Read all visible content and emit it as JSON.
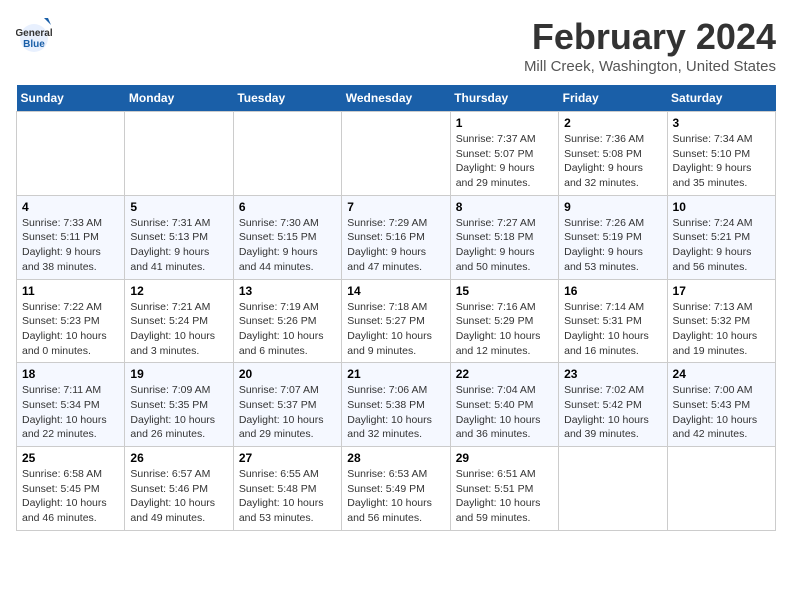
{
  "header": {
    "month_year": "February 2024",
    "location": "Mill Creek, Washington, United States",
    "logo_line1": "General",
    "logo_line2": "Blue"
  },
  "days_of_week": [
    "Sunday",
    "Monday",
    "Tuesday",
    "Wednesday",
    "Thursday",
    "Friday",
    "Saturday"
  ],
  "weeks": [
    [
      {
        "day": "",
        "info": ""
      },
      {
        "day": "",
        "info": ""
      },
      {
        "day": "",
        "info": ""
      },
      {
        "day": "",
        "info": ""
      },
      {
        "day": "1",
        "info": "Sunrise: 7:37 AM\nSunset: 5:07 PM\nDaylight: 9 hours\nand 29 minutes."
      },
      {
        "day": "2",
        "info": "Sunrise: 7:36 AM\nSunset: 5:08 PM\nDaylight: 9 hours\nand 32 minutes."
      },
      {
        "day": "3",
        "info": "Sunrise: 7:34 AM\nSunset: 5:10 PM\nDaylight: 9 hours\nand 35 minutes."
      }
    ],
    [
      {
        "day": "4",
        "info": "Sunrise: 7:33 AM\nSunset: 5:11 PM\nDaylight: 9 hours\nand 38 minutes."
      },
      {
        "day": "5",
        "info": "Sunrise: 7:31 AM\nSunset: 5:13 PM\nDaylight: 9 hours\nand 41 minutes."
      },
      {
        "day": "6",
        "info": "Sunrise: 7:30 AM\nSunset: 5:15 PM\nDaylight: 9 hours\nand 44 minutes."
      },
      {
        "day": "7",
        "info": "Sunrise: 7:29 AM\nSunset: 5:16 PM\nDaylight: 9 hours\nand 47 minutes."
      },
      {
        "day": "8",
        "info": "Sunrise: 7:27 AM\nSunset: 5:18 PM\nDaylight: 9 hours\nand 50 minutes."
      },
      {
        "day": "9",
        "info": "Sunrise: 7:26 AM\nSunset: 5:19 PM\nDaylight: 9 hours\nand 53 minutes."
      },
      {
        "day": "10",
        "info": "Sunrise: 7:24 AM\nSunset: 5:21 PM\nDaylight: 9 hours\nand 56 minutes."
      }
    ],
    [
      {
        "day": "11",
        "info": "Sunrise: 7:22 AM\nSunset: 5:23 PM\nDaylight: 10 hours\nand 0 minutes."
      },
      {
        "day": "12",
        "info": "Sunrise: 7:21 AM\nSunset: 5:24 PM\nDaylight: 10 hours\nand 3 minutes."
      },
      {
        "day": "13",
        "info": "Sunrise: 7:19 AM\nSunset: 5:26 PM\nDaylight: 10 hours\nand 6 minutes."
      },
      {
        "day": "14",
        "info": "Sunrise: 7:18 AM\nSunset: 5:27 PM\nDaylight: 10 hours\nand 9 minutes."
      },
      {
        "day": "15",
        "info": "Sunrise: 7:16 AM\nSunset: 5:29 PM\nDaylight: 10 hours\nand 12 minutes."
      },
      {
        "day": "16",
        "info": "Sunrise: 7:14 AM\nSunset: 5:31 PM\nDaylight: 10 hours\nand 16 minutes."
      },
      {
        "day": "17",
        "info": "Sunrise: 7:13 AM\nSunset: 5:32 PM\nDaylight: 10 hours\nand 19 minutes."
      }
    ],
    [
      {
        "day": "18",
        "info": "Sunrise: 7:11 AM\nSunset: 5:34 PM\nDaylight: 10 hours\nand 22 minutes."
      },
      {
        "day": "19",
        "info": "Sunrise: 7:09 AM\nSunset: 5:35 PM\nDaylight: 10 hours\nand 26 minutes."
      },
      {
        "day": "20",
        "info": "Sunrise: 7:07 AM\nSunset: 5:37 PM\nDaylight: 10 hours\nand 29 minutes."
      },
      {
        "day": "21",
        "info": "Sunrise: 7:06 AM\nSunset: 5:38 PM\nDaylight: 10 hours\nand 32 minutes."
      },
      {
        "day": "22",
        "info": "Sunrise: 7:04 AM\nSunset: 5:40 PM\nDaylight: 10 hours\nand 36 minutes."
      },
      {
        "day": "23",
        "info": "Sunrise: 7:02 AM\nSunset: 5:42 PM\nDaylight: 10 hours\nand 39 minutes."
      },
      {
        "day": "24",
        "info": "Sunrise: 7:00 AM\nSunset: 5:43 PM\nDaylight: 10 hours\nand 42 minutes."
      }
    ],
    [
      {
        "day": "25",
        "info": "Sunrise: 6:58 AM\nSunset: 5:45 PM\nDaylight: 10 hours\nand 46 minutes."
      },
      {
        "day": "26",
        "info": "Sunrise: 6:57 AM\nSunset: 5:46 PM\nDaylight: 10 hours\nand 49 minutes."
      },
      {
        "day": "27",
        "info": "Sunrise: 6:55 AM\nSunset: 5:48 PM\nDaylight: 10 hours\nand 53 minutes."
      },
      {
        "day": "28",
        "info": "Sunrise: 6:53 AM\nSunset: 5:49 PM\nDaylight: 10 hours\nand 56 minutes."
      },
      {
        "day": "29",
        "info": "Sunrise: 6:51 AM\nSunset: 5:51 PM\nDaylight: 10 hours\nand 59 minutes."
      },
      {
        "day": "",
        "info": ""
      },
      {
        "day": "",
        "info": ""
      }
    ]
  ]
}
